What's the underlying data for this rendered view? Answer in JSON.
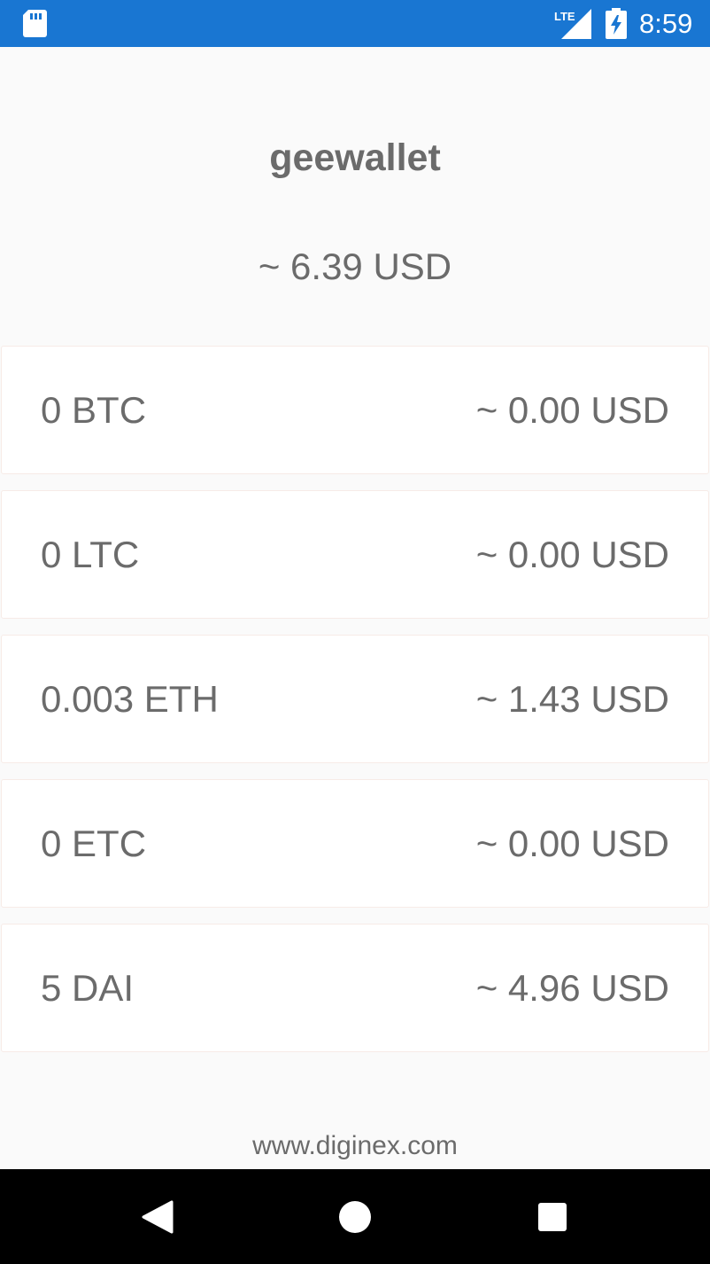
{
  "status_bar": {
    "time": "8:59",
    "network_label": "LTE",
    "icons": [
      "sd-card-icon",
      "lte-signal-icon",
      "battery-charging-icon"
    ]
  },
  "header": {
    "title": "geewallet",
    "total_balance": "~ 6.39 USD"
  },
  "accounts": [
    {
      "amount": "0 BTC",
      "value": "~ 0.00 USD"
    },
    {
      "amount": "0 LTC",
      "value": "~ 0.00 USD"
    },
    {
      "amount": "0.003 ETH",
      "value": "~ 1.43 USD"
    },
    {
      "amount": "0 ETC",
      "value": "~ 0.00 USD"
    },
    {
      "amount": "5 DAI",
      "value": "~ 4.96 USD"
    }
  ],
  "footer": {
    "link": "www.diginex.com"
  },
  "nav_bar": {
    "icons": [
      "back-icon",
      "home-icon",
      "recent-apps-icon"
    ]
  },
  "colors": {
    "status_bar": "#1976d2",
    "background": "#fafafa",
    "text": "#6b6b6b",
    "card_border": "#f7ebe7",
    "nav_bar": "#000000"
  }
}
